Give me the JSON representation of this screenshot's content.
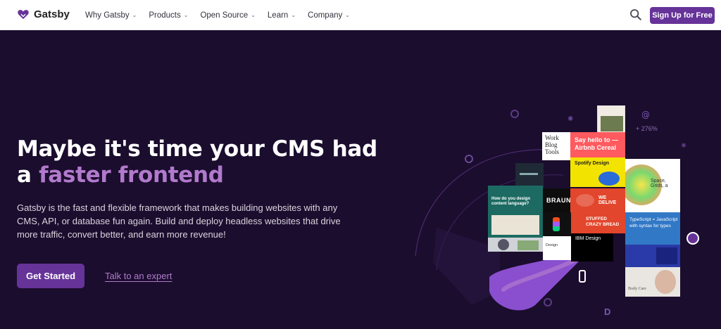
{
  "nav": {
    "brand": "Gatsby",
    "menu": [
      {
        "label": "Why Gatsby"
      },
      {
        "label": "Products"
      },
      {
        "label": "Open Source"
      },
      {
        "label": "Learn"
      },
      {
        "label": "Company"
      }
    ],
    "signup": "Sign Up for Free"
  },
  "hero": {
    "headline_line1": "Maybe it's time your CMS had",
    "headline_prefix": "a ",
    "headline_accent": "faster frontend",
    "description": "Gatsby is the fast and flexible framework that makes building websites with any CMS, API, or database fun again. Build and deploy headless websites that drive more traffic, convert better, and earn more revenue!",
    "cta_primary": "Get Started",
    "cta_secondary": "Talk to an expert"
  },
  "illustration": {
    "stat": "+ 276%",
    "tiles": {
      "work_blog": "Work Blog Tools",
      "airbnb": "Say hello to — Airbnb Cereal",
      "spotify": "Spotify Design",
      "space": "Space, Grids, a",
      "braun": "BRAUN",
      "deliver": "WE DELIVE",
      "crazy_bread": "STUFFED CRAZY BREAD",
      "typescript": "TypeScript = JavaScript with syntax for types",
      "ibm": "IBM Design",
      "design_content": "How do you design content language?",
      "design": "Design",
      "body_care": "Body Care"
    }
  },
  "colors": {
    "brand": "#663399",
    "accent": "#b17acc",
    "hero_bg": "#1b0d2e"
  },
  "icons": [
    "gatsby-logo-icon",
    "chevron-down-icon",
    "search-icon"
  ]
}
